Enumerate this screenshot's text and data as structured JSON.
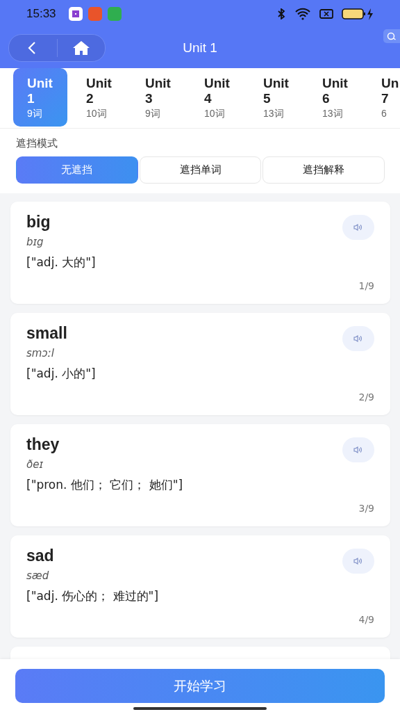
{
  "status_bar": {
    "time": "15:33"
  },
  "header": {
    "title": "Unit 1"
  },
  "units": [
    {
      "label": "Unit",
      "number": "1",
      "count": "9词",
      "selected": true
    },
    {
      "label": "Unit",
      "number": "2",
      "count": "10词",
      "selected": false
    },
    {
      "label": "Unit",
      "number": "3",
      "count": "9词",
      "selected": false
    },
    {
      "label": "Unit",
      "number": "4",
      "count": "10词",
      "selected": false
    },
    {
      "label": "Unit",
      "number": "5",
      "count": "13词",
      "selected": false
    },
    {
      "label": "Unit",
      "number": "6",
      "count": "13词",
      "selected": false
    },
    {
      "label": "Un",
      "number": "7",
      "count": "6",
      "selected": false
    }
  ],
  "mode": {
    "label": "遮挡模式",
    "options": [
      {
        "label": "无遮挡",
        "selected": true
      },
      {
        "label": "遮挡单词",
        "selected": false
      },
      {
        "label": "遮挡解释",
        "selected": false
      }
    ]
  },
  "words": [
    {
      "word": "big",
      "phonetic": "bɪg",
      "meaning": "[\"adj. 大的\"]",
      "index": "1/9"
    },
    {
      "word": "small",
      "phonetic": "smɔːl",
      "meaning": "[\"adj. 小的\"]",
      "index": "2/9"
    },
    {
      "word": "they",
      "phonetic": "ðeɪ",
      "meaning": "[\"pron. 他们； 它们； 她们\"]",
      "index": "3/9"
    },
    {
      "word": "sad",
      "phonetic": "sæd",
      "meaning": "[\"adj. 伤心的； 难过的\"]",
      "index": "4/9"
    }
  ],
  "start_button": "开始学习"
}
